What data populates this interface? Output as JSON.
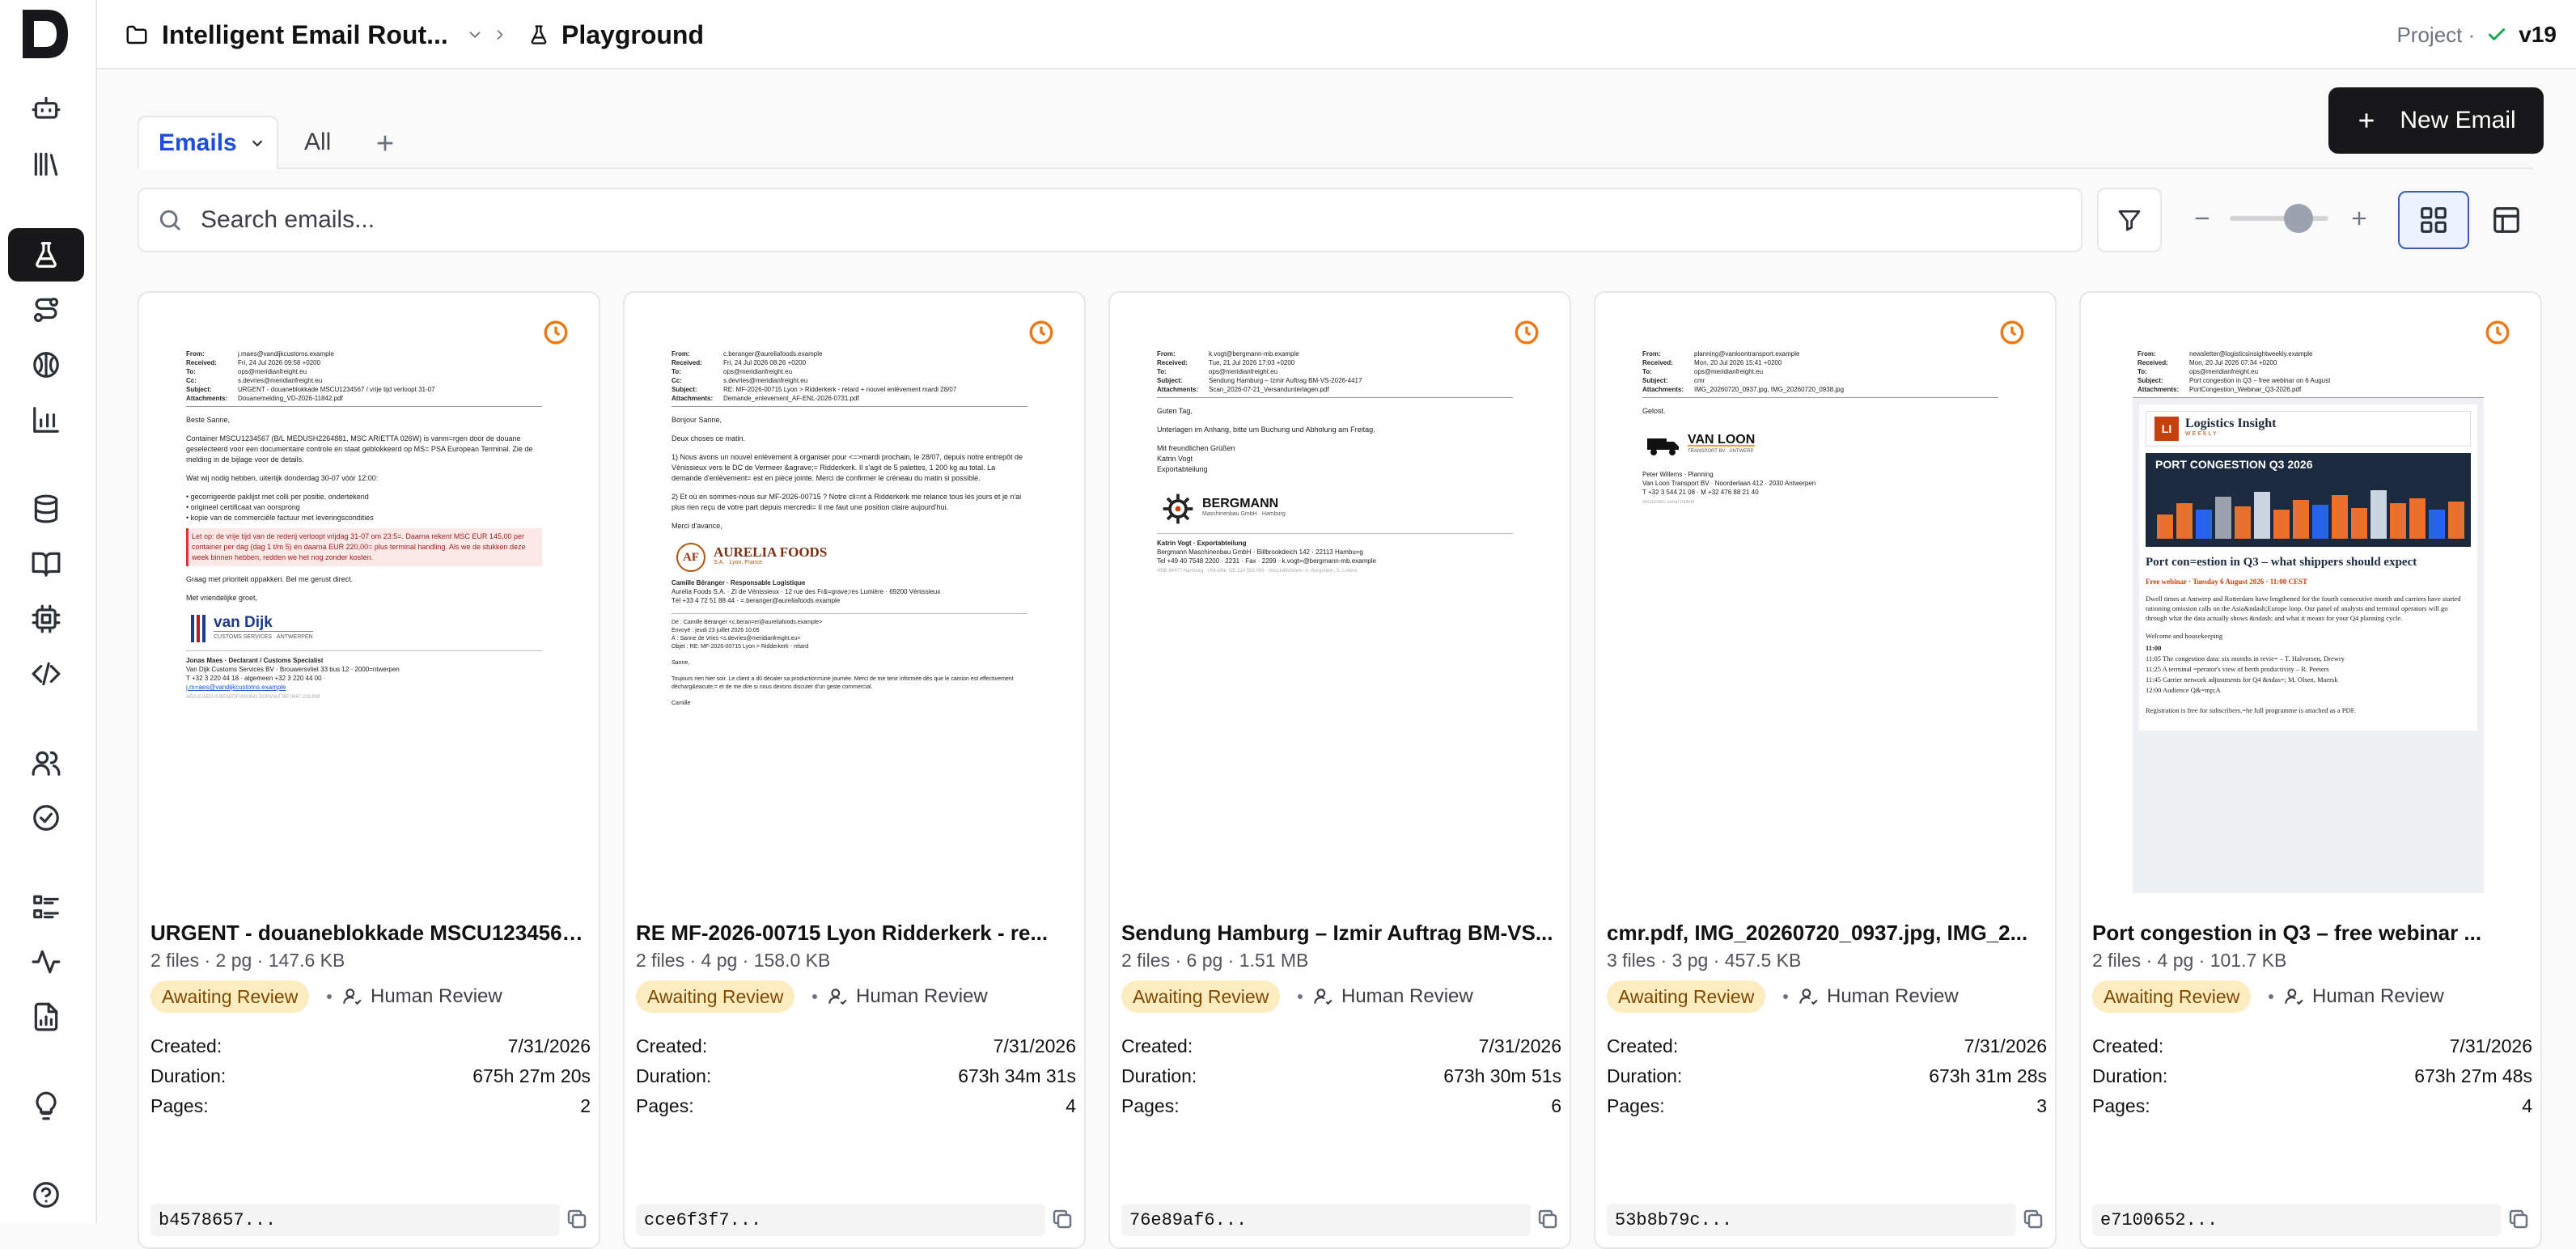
{
  "header": {
    "workflow_title": "Intelligent Email Rout...",
    "page_title": "Playground",
    "project_label": "Project ·",
    "version": "v19"
  },
  "tabs": {
    "emails_label": "Emails",
    "all_label": "All"
  },
  "new_email_label": "New Email",
  "search": {
    "placeholder": "Search emails..."
  },
  "zoom": {
    "level_fraction": 0.7
  },
  "labels": {
    "created": "Created:",
    "duration": "Duration:",
    "pages": "Pages:",
    "status": "Awaiting Review",
    "review_type": "Human Review"
  },
  "sidebar_icons": [
    "bot-icon",
    "library-icon",
    "flask-icon",
    "route-icon",
    "brain-icon",
    "chart-icon",
    "database-icon",
    "book-icon",
    "chip-icon",
    "code-icon",
    "users-icon",
    "check-circle-icon",
    "list-icon",
    "activity-icon",
    "file-chart-icon",
    "lightbulb-icon",
    "help-icon"
  ],
  "colors": {
    "accent": "#1d4ed8",
    "status_bg": "#fdecc0",
    "pending": "#ea7a17",
    "primary_button": "#18181b"
  },
  "cards": [
    {
      "title": "URGENT - douaneblokkade MSCU1234567 v...",
      "meta": "2 files · 2 pg · 147.6 KB",
      "created": "7/31/2026",
      "duration": "675h 27m 20s",
      "pages": "2",
      "hash": "b4578657...",
      "preview": {
        "from": "j.maes@vandijkcustoms.example",
        "received": "Fri, 24 Jul 2026 09:58 +0200",
        "to": "ops@meridianfreight.eu",
        "cc": "s.devries@meridianfreight.eu",
        "subject": "URGENT - douaneblokkade MSCU1234567 / vrije tijd verloopt 31-07",
        "attachments": "Douanemelding_VD-2026-11842.pdf",
        "greeting": "Beste Sanne,",
        "body1": "Container MSCU1234567 (B/L MEDUSH2264881, MSC ARIETTA 026W) is vanm=rgen door de douane geselecteerd voor een documentaire controle en staat geblokkeerd op MS= PSA European Terminal. Zie de melding in de bijlage voor de details.",
        "body2": "Wat wij nodig hebben, uiterlijk donderdag 30-07 vóór 12:00:",
        "bullets": [
          "gecorrigeerde paklijst met colli per positie, ondertekend",
          "origineel certificaat van oorsprong",
          "kopie van de commerciële factuur met leveringscondities"
        ],
        "warning": "Let op: de vrije tijd van de rederij verloopt vrijdag 31-07 om 23:5=. Daarna rekent MSC EUR 145,00 per container per dag (dag 1 t/m 5) en daarna EUR 220,00= plus terminal handling. Als we de stukken deze week binnen hebben, redden we het nog zonder kosten.",
        "body3": "Graag met prioriteit oppakken. Bel me gerust direct.",
        "closing": "Met vriendelijke groet,",
        "logo": "van Dijk",
        "logo_sub": "CUSTOMS SERVICES · ANTWERPEN",
        "sig1": "Jonas Maes · Declarant / Customs Specialist",
        "sig2": "Van Dijk Customs Services BV · Brouwersvliet 33 bus 12 · 2000=ntwerpen",
        "sig3": "T +32 3 220 44 18 · algemeen +32 3 220 44 00 ·",
        "sig4": "j.m=aes@vandijkcustoms.example",
        "sig5": "AEO-C/AEO-S BEAEOF0000041 EORI/VAT BE 0447.233.808"
      }
    },
    {
      "title": "RE MF-2026-00715 Lyon Ridderkerk - re...",
      "meta": "2 files · 4 pg · 158.0 KB",
      "created": "7/31/2026",
      "duration": "673h 34m 31s",
      "pages": "4",
      "hash": "cce6f3f7...",
      "preview": {
        "from": "c.beranger@aureliafoods.example",
        "received": "Fri, 24 Jul 2026 08:26 +0200",
        "to": "ops@meridianfreight.eu",
        "cc": "s.devries@meridianfreight.eu",
        "subject": "RE: MF-2026-00715 Lyon > Ridderkerk - retard + nouvel enlèvement mardi 28/07",
        "attachments": "Demande_enlevement_AF-ENL-2026-0731.pdf",
        "greeting": "Bonjour Sanne,",
        "body1": "Deux choses ce matin.",
        "body2": "1) Nous avons un nouvel enlèvement à organiser pour <=>mardi prochain, le 28/07, depuis notre entrepôt de Vénissieux vers le DC de Vermeer &agrave;= Ridderkerk. Il s'agit de 5 palettes, 1 200 kg au total. La demande d'enlèvement= est en pièce jointe. Merci de confirmer le créneau du matin si possible.",
        "body3": "2) Et où en sommes-nous sur MF-2026-00715 ? Notre cli=nt à Ridderkerk me relance tous les jours et je n'ai plus rien reçu de votre part depuis mercredi= Il me faut une position claire aujourd'hui.",
        "closing": "Merci d'avance,",
        "logo": "AURELIA FOODS",
        "logo_sub": "S.A. · Lyon, France",
        "sig1": "Camille Béranger · Responsable Logistique",
        "sig2": "Aurelia Foods S.A. · ZI de Vénissieux · 12 rue des Fr&=grave;res Lumière · 69200 Vénissieux",
        "sig3": "Tél +33 4 72 51 88 44 · =.beranger@aureliafoods.example",
        "q1": "De : Camille Béranger <c.beran=er@aureliafoods.example>",
        "q2": "Envoyé : jeudi 23 juillet 2026 10:05",
        "q3": "À : Sanne de Vries <s.devries@meridianfreight.eu>",
        "q4": "Objet : RE: MF-2026-00715 Lyon > Ridderkerk - retard",
        "q5": "Sanne,",
        "q6": "Toujours rien hier soir. Le client a dû décaler sa production=une journée. Merci de me tenir informée dès que le camion est effectivement décharg&eacute;= et de me dire si nous devons discuter d'un geste commercial.",
        "q7": "Camille"
      }
    },
    {
      "title": "Sendung Hamburg – Izmir Auftrag BM-VS...",
      "meta": "2 files · 6 pg · 1.51 MB",
      "created": "7/31/2026",
      "duration": "673h 30m 51s",
      "pages": "6",
      "hash": "76e89af6...",
      "preview": {
        "from": "k.vogt@bergmann-mb.example",
        "received": "Tue, 21 Jul 2026 17:03 +0200",
        "to": "ops@meridianfreight.eu",
        "subject": "Sendung Hamburg – Izmir Auftrag BM-VS-2026-4417",
        "attachments": "Scan_2026-07-21_Versandunterlagen.pdf",
        "greeting": "Guten Tag,",
        "body1": "Unterlagen im Anhang, bitte um Buchung und Abholung am Freitag.",
        "closing": "Mit freundlichen Grüßen",
        "closing2": "Katrin Vogt",
        "closing3": "Exportabteilung",
        "logo": "BERGMANN",
        "logo_sub": "Maschinenbau GmbH · Hamburg",
        "sig1": "Katrin Vogt · Exportabteilung",
        "sig2": "Bergmann Maschinenbau GmbH · Billbrookdeich 142 · 22113 Hambu=g",
        "sig3": "Tel +49 40 7548 2200 · 2231 · Fax · 2299 · k.vogt=@bergmann-mb.example",
        "sig4": "HRB 84477 Hamburg · USt-IdNr. DE 214 553 093 · Geschäftsführer: A. Bergmann, S. Lorenz"
      }
    },
    {
      "title": "cmr.pdf, IMG_20260720_0937.jpg, IMG_2...",
      "meta": "3 files · 3 pg · 457.5 KB",
      "created": "7/31/2026",
      "duration": "673h 31m 28s",
      "pages": "3",
      "hash": "53b8b79c...",
      "preview": {
        "from": "planning@vanloontransport.example",
        "received": "Mon, 20 Jul 2026 15:41 +0200",
        "to": "ops@meridianfreight.eu",
        "subject": "cmr",
        "attachments": "IMG_20260720_0937.jpg, IMG_20260720_0938.jpg",
        "greeting": "Gelost.",
        "logo": "VAN LOON",
        "logo_sub": "TRANSPORT BV · ANTWERP",
        "sig1": "Peter Willems · Planning",
        "sig2": "Van Loon Transport BV · Noorderlaan 412 · 2030 Antwerpen",
        "sig3": "T +32 3 544 21 08 · M +32 476 88 21 40",
        "sig4": "Verzonden vanaf mobiel"
      }
    },
    {
      "title": "Port congestion in Q3 – free webinar ...",
      "meta": "2 files · 4 pg · 101.7 KB",
      "created": "7/31/2026",
      "duration": "673h 27m 48s",
      "pages": "4",
      "hash": "e7100652...",
      "preview": {
        "from": "newsletter@logisticsinsightweekly.example",
        "received": "Mon, 20 Jul 2026 07:34 +0200",
        "to": "ops@meridianfreight.eu",
        "subject": "Port congestion in Q3 – free webinar on 6 August",
        "attachments": "PortCongestion_Webinar_Q3-2026.pdf",
        "logo": "Logistics Insight",
        "logo_sub": "WEEKLY",
        "banner": "PORT CONGESTION Q3 2026",
        "headline": "Port con=estion in Q3 – what shippers should expect",
        "event": "Free webinar · Tuesday 6 August 2026 · 11:00 CEST",
        "body1": "Dwell times at Antwerp and Rotterdam have lengthened for the fourth consecutive month and carriers have started rationing omission calls on the Asia&ndash;Europe loop. Our panel of analysts and terminal operators will go through what the data actually shows &ndash; and what it means for your Q4 planning cycle.",
        "agenda_title": "Welcome and housekeeping",
        "agenda": [
          "11:00",
          "11:05 The congestion data: six months in revie= – T. Halvorsen, Drewry",
          "11:25 A terminal =perator's view of berth productivity – R. Peeters",
          "11:45 Carrier network adjustments for Q4 &ndas=; M. Olsen, Maersk",
          "12:00 Audience Q&=mp;A"
        ],
        "footer": "Registration is free for subscribers.=he full programme is attached as a PDF."
      }
    }
  ]
}
